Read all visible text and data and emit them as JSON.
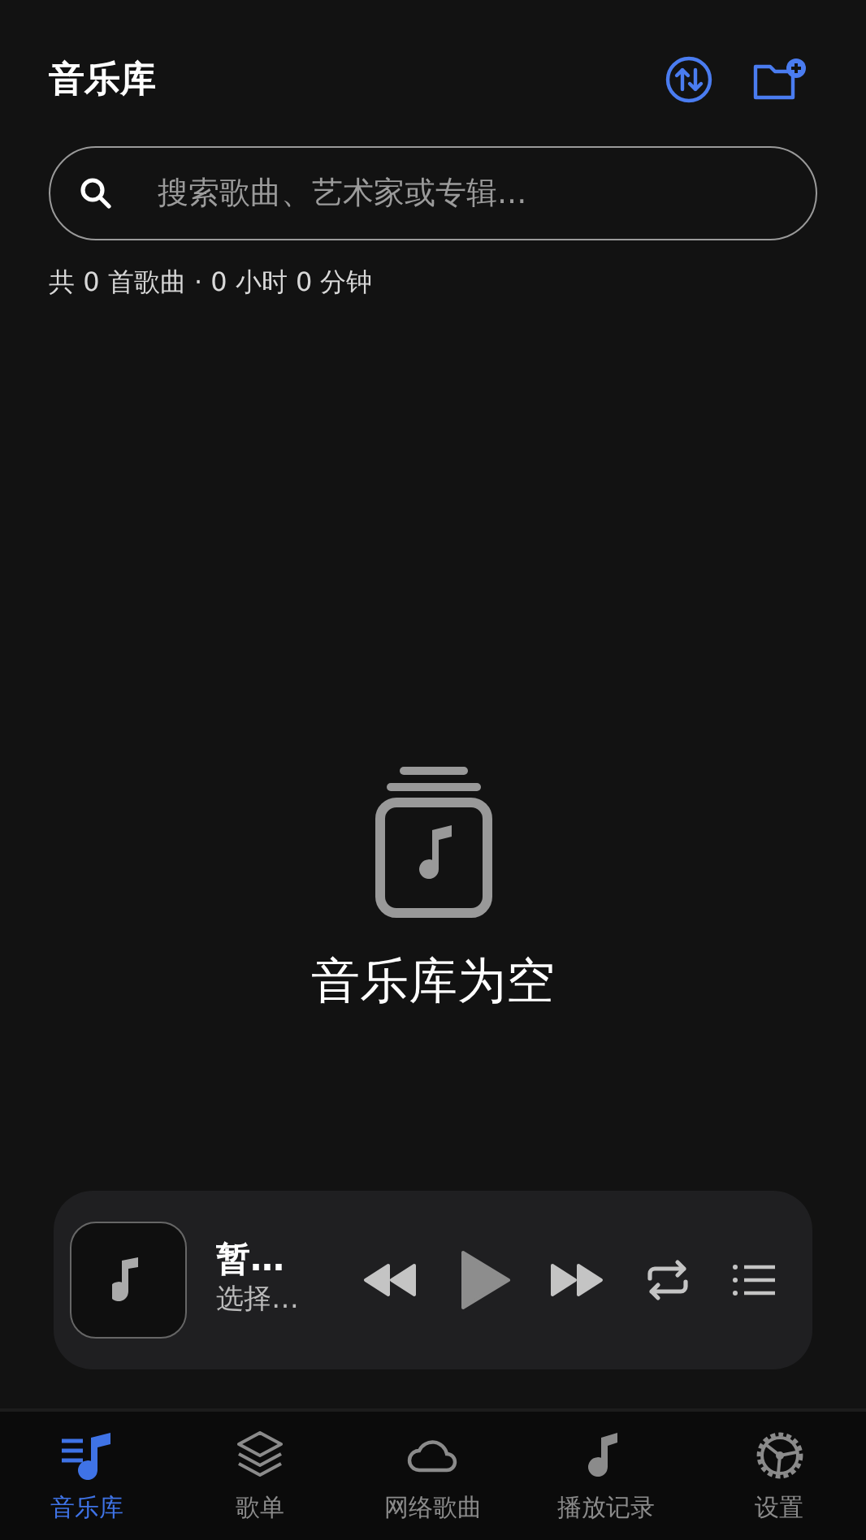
{
  "header": {
    "title": "音乐库"
  },
  "search": {
    "placeholder": "搜索歌曲、艺术家或专辑..."
  },
  "summary": "共 0 首歌曲 · 0 小时 0 分钟",
  "empty_state": {
    "message": "音乐库为空"
  },
  "mini_player": {
    "title": "暂…",
    "subtitle": "选择…"
  },
  "tabs": [
    {
      "label": "音乐库",
      "selected": true
    },
    {
      "label": "歌单",
      "selected": false
    },
    {
      "label": "网络歌曲",
      "selected": false
    },
    {
      "label": "播放记录",
      "selected": false
    },
    {
      "label": "设置",
      "selected": false
    }
  ]
}
